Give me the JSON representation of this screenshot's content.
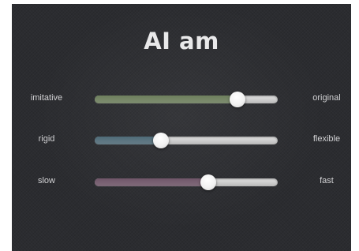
{
  "title": "AI am",
  "sliders": [
    {
      "left_label": "imitative",
      "right_label": "original",
      "value": 0.78,
      "fill_color": "#6d7f5c"
    },
    {
      "left_label": "rigid",
      "right_label": "flexible",
      "value": 0.36,
      "fill_color": "#4f6b78"
    },
    {
      "left_label": "slow",
      "right_label": "fast",
      "value": 0.62,
      "fill_color": "#6f5568"
    }
  ]
}
